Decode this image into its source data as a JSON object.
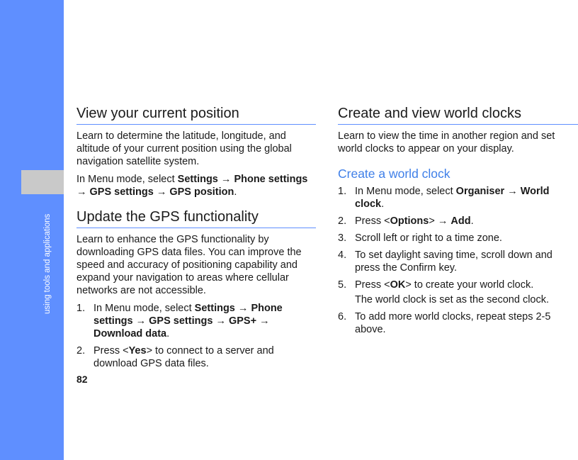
{
  "sidebar": {
    "chapter": "using tools and applications"
  },
  "page_number": "82",
  "arrow": "→",
  "left": {
    "s1_title": "View your current position",
    "s1_p1": "Learn to determine the latitude, longitude, and altitude of your current position using the global navigation satellite system.",
    "s1_p2_pre": "In Menu mode, select ",
    "s1_p2_settings": "Settings",
    "s1_p2_phone": "Phone settings",
    "s1_p2_gps": "GPS settings",
    "s1_p2_pos": "GPS position",
    "s1_p2_end": ".",
    "s2_title": "Update the GPS functionality",
    "s2_p1": "Learn to enhance the GPS functionality by downloading GPS data files. You can improve the speed and accuracy of positioning capability and expand your navigation to areas where cellular networks are not accessible.",
    "step1_num": "1.",
    "step1_pre": "In Menu mode, select ",
    "step1_settings": "Settings",
    "step1_phone": "Phone settings",
    "step1_gps": "GPS settings",
    "step1_gpsplus": "GPS+",
    "step1_download": "Download data",
    "step1_end": ".",
    "step2_num": "2.",
    "step2_pre": "Press <",
    "step2_key": "Yes",
    "step2_post": "> to connect to a server and download GPS data files."
  },
  "right": {
    "s3_title": "Create and view world clocks",
    "s3_p1": "Learn to view the time in another region and set world clocks to appear on your display.",
    "sub_title": "Create a world clock",
    "step1_num": "1.",
    "step1_pre": "In Menu mode, select ",
    "step1_organiser": "Organiser",
    "step1_clock": "World clock",
    "step1_end": ".",
    "step2_num": "2.",
    "step2_pre": "Press <",
    "step2_key": "Options",
    "step2_mid": ">",
    "step2_add": "Add",
    "step2_end": ".",
    "step3_num": "3.",
    "step3_text": "Scroll left or right to a time zone.",
    "step4_num": "4.",
    "step4_text": "To set daylight saving time, scroll down and press the Confirm key.",
    "step5_num": "5.",
    "step5_pre": "Press <",
    "step5_key": "OK",
    "step5_post": "> to create your world clock.",
    "step5_note": "The world clock is set as the second clock.",
    "step6_num": "6.",
    "step6_text": "To add more world clocks, repeat steps 2-5 above."
  }
}
